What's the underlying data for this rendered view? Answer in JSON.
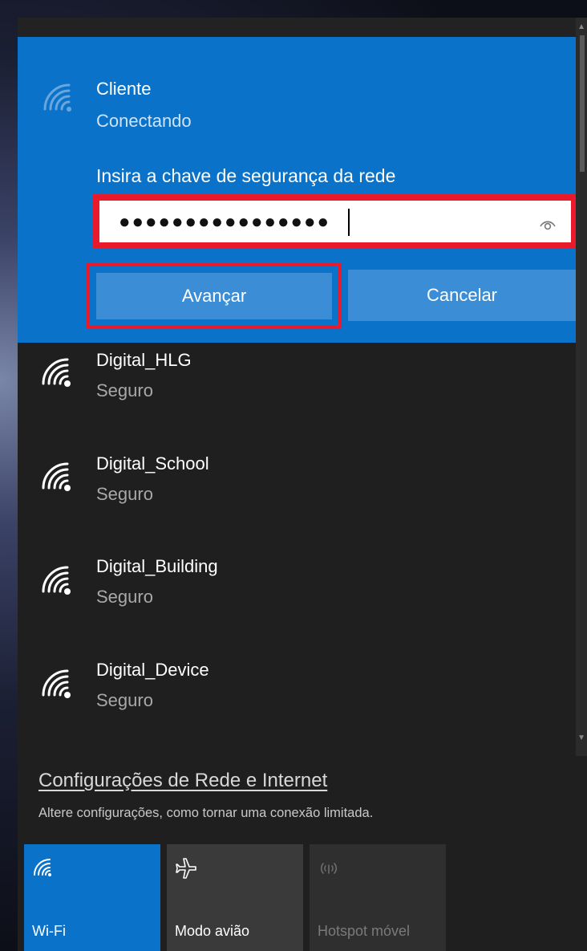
{
  "connecting_network": {
    "name": "Cliente",
    "status": "Conectando",
    "security_prompt": "Insira a chave de segurança da rede",
    "password_masked": "●●●●●●●●●●●●●●●●",
    "next_label": "Avançar",
    "cancel_label": "Cancelar"
  },
  "networks": [
    {
      "name": "Digital_HLG",
      "status": "Seguro"
    },
    {
      "name": "Digital_School",
      "status": "Seguro"
    },
    {
      "name": "Digital_Building",
      "status": "Seguro"
    },
    {
      "name": "Digital_Device",
      "status": "Seguro"
    }
  ],
  "settings": {
    "link": "Configurações de Rede e Internet",
    "description": "Altere configurações, como tornar uma conexão limitada."
  },
  "quick_actions": [
    {
      "label": "Wi-Fi",
      "icon": "wifi-icon",
      "state": "on"
    },
    {
      "label": "Modo avião",
      "icon": "airplane-icon",
      "state": "off"
    },
    {
      "label": "Hotspot móvel",
      "icon": "hotspot-icon",
      "state": "disabled"
    }
  ],
  "colors": {
    "accent": "#0a73c9",
    "button": "#3b8ed6",
    "highlight": "#e81a2c",
    "background": "#1f1f1f"
  }
}
